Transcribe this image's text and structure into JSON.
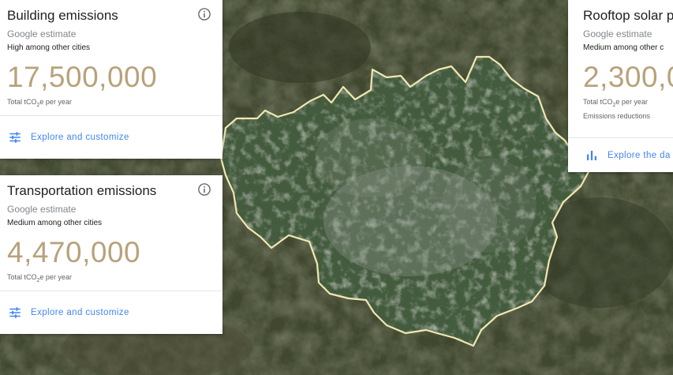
{
  "colors": {
    "value": "#b8a27c",
    "link": "#4285f4",
    "boundary": "#f1e7b2"
  },
  "cards": {
    "building": {
      "title": "Building emissions",
      "subtitle": "Google estimate",
      "rank": "High among other cities",
      "value": "17,500,000",
      "unit_prefix": "Total tCO",
      "unit_sub": "2",
      "unit_suffix": "e per year",
      "action": "Explore and customize",
      "action_icon": "tune-icon",
      "info_icon": "info-icon"
    },
    "transport": {
      "title": "Transportation emissions",
      "subtitle": "Google estimate",
      "rank": "Medium among other cities",
      "value": "4,470,000",
      "unit_prefix": "Total tCO",
      "unit_sub": "2",
      "unit_suffix": "e per year",
      "action": "Explore and customize",
      "action_icon": "tune-icon",
      "info_icon": "info-icon"
    },
    "solar": {
      "title": "Rooftop solar p",
      "subtitle": "Google estimate",
      "rank": "Medium among other c",
      "value": "2,300,0",
      "unit_prefix": "Total tCO",
      "unit_sub": "2",
      "unit_suffix": "e per year",
      "unit_line2": "Emissions reductions",
      "action": "Explore the da",
      "action_icon": "bar-chart-icon"
    }
  }
}
